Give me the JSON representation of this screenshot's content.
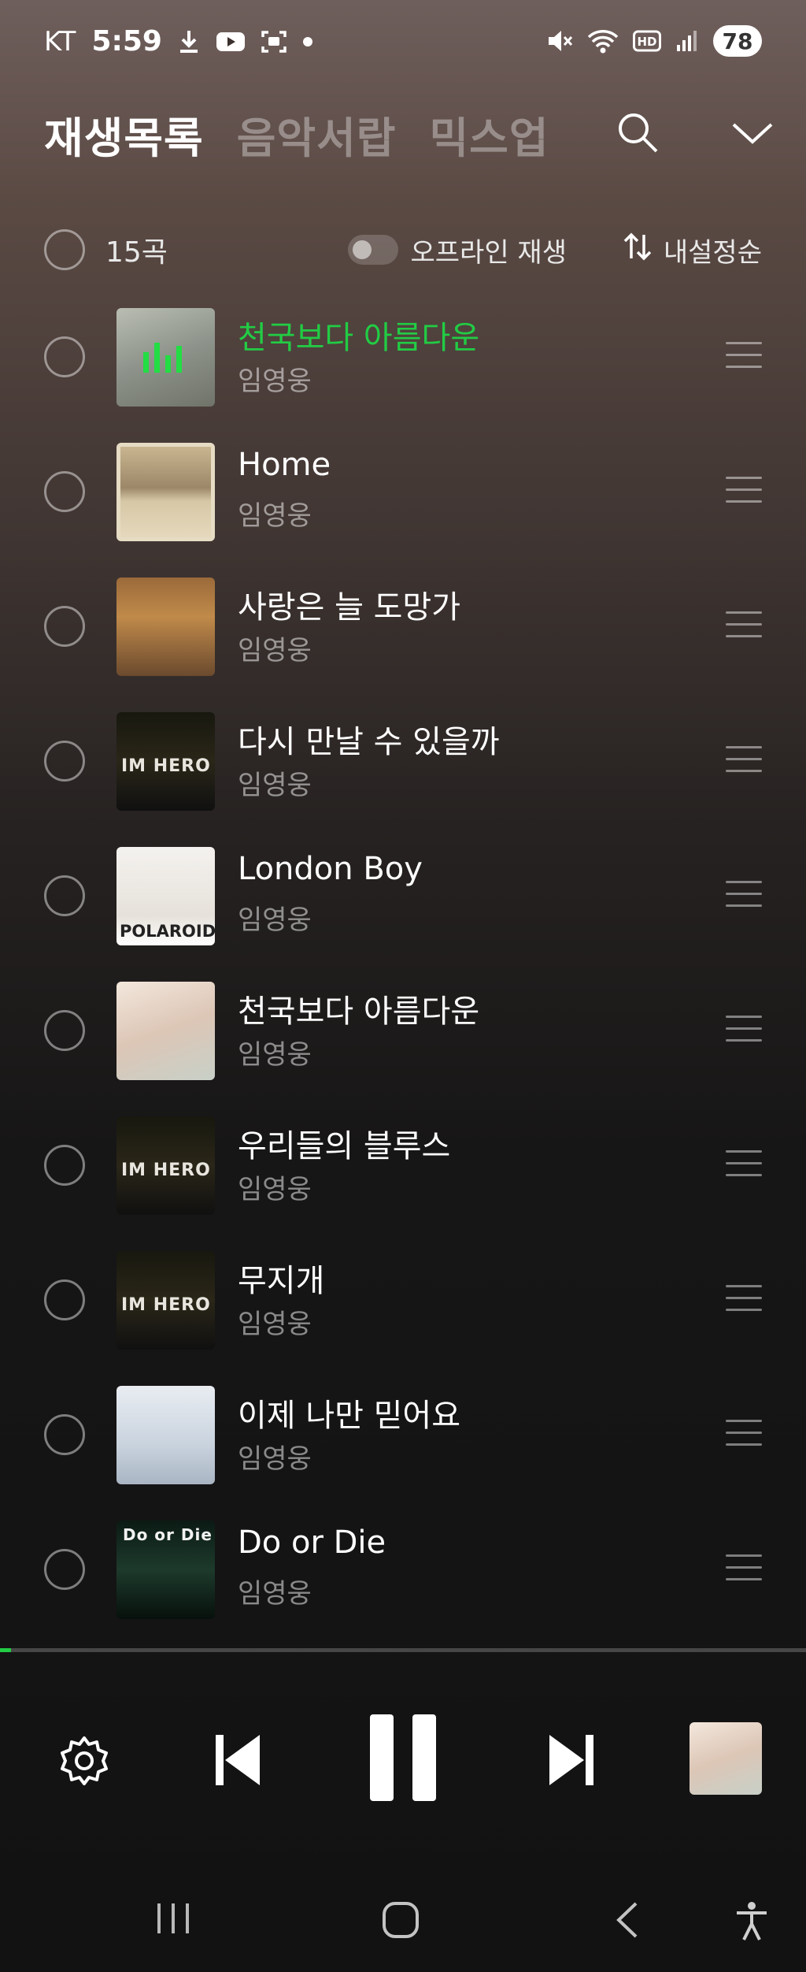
{
  "status_bar": {
    "carrier": "KT",
    "time": "5:59",
    "battery": "78",
    "icons": [
      "download-icon",
      "youtube-icon",
      "screenshot-icon",
      "dot-icon",
      "mute-icon",
      "wifi-icon",
      "hd-icon",
      "signal-icon"
    ]
  },
  "header": {
    "tabs": [
      {
        "label": "재생목록",
        "active": true
      },
      {
        "label": "음악서랍",
        "active": false
      },
      {
        "label": "믹스업",
        "active": false
      }
    ],
    "icons": [
      "search-icon",
      "chevron-down-icon"
    ]
  },
  "toolbar": {
    "count": "15곡",
    "offline_label": "오프라인 재생",
    "offline_enabled": false,
    "sort_label": "내설정순"
  },
  "tracks": [
    {
      "title": "천국보다 아름다운",
      "artist": "임영웅",
      "playing": true
    },
    {
      "title": "Home",
      "artist": "임영웅",
      "playing": false
    },
    {
      "title": "사랑은 늘 도망가",
      "artist": "임영웅",
      "playing": false
    },
    {
      "title": "다시 만날 수 있을까",
      "artist": "임영웅",
      "playing": false
    },
    {
      "title": "London Boy",
      "artist": "임영웅",
      "playing": false
    },
    {
      "title": "천국보다 아름다운",
      "artist": "임영웅",
      "playing": false
    },
    {
      "title": "우리들의 블루스",
      "artist": "임영웅",
      "playing": false
    },
    {
      "title": "무지개",
      "artist": "임영웅",
      "playing": false
    },
    {
      "title": "이제 나만 믿어요",
      "artist": "임영웅",
      "playing": false
    },
    {
      "title": "Do or Die",
      "artist": "임영웅",
      "playing": false
    }
  ],
  "album_art_text": {
    "im_hero": "IM HERO",
    "polaroid": "POLAROID",
    "do_or_die": "Do or Die"
  },
  "progress_fraction": 0.014,
  "player": {
    "icons": [
      "settings-icon",
      "previous-icon",
      "pause-icon",
      "next-icon"
    ]
  },
  "navbar": {
    "icons": [
      "recents-icon",
      "home-icon",
      "back-icon",
      "accessibility-icon"
    ]
  },
  "colors": {
    "accent_green": "#22cc44"
  }
}
